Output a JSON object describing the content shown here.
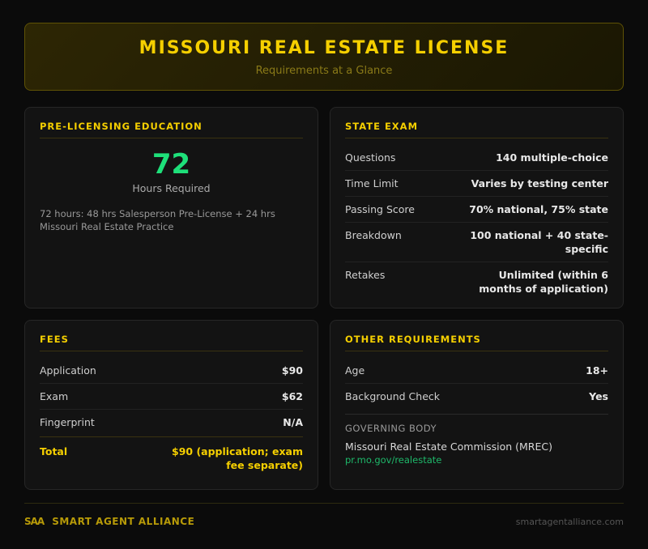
{
  "header": {
    "title": "MISSOURI REAL ESTATE LICENSE",
    "subtitle": "Requirements at a Glance"
  },
  "education": {
    "title": "PRE-LICENSING EDUCATION",
    "hours": "72",
    "hours_label": "Hours Required",
    "description": "72 hours: 48 hrs Salesperson Pre-License + 24 hrs Missouri Real Estate Practice"
  },
  "exam": {
    "title": "STATE EXAM",
    "rows": [
      {
        "label": "Questions",
        "value": "140 multiple-choice"
      },
      {
        "label": "Time Limit",
        "value": "Varies by testing center"
      },
      {
        "label": "Passing Score",
        "value": "70% national, 75% state"
      },
      {
        "label": "Breakdown",
        "value": "100 national + 40 state-specific"
      },
      {
        "label": "Retakes",
        "value": "Unlimited (within 6 months of application)"
      }
    ]
  },
  "fees": {
    "title": "FEES",
    "rows": [
      {
        "label": "Application",
        "value": "$90"
      },
      {
        "label": "Exam",
        "value": "$62"
      },
      {
        "label": "Fingerprint",
        "value": "N/A"
      }
    ],
    "total_label": "Total",
    "total_value": "$90 (application; exam fee separate)"
  },
  "other": {
    "title": "OTHER REQUIREMENTS",
    "rows": [
      {
        "label": "Age",
        "value": "18+"
      },
      {
        "label": "Background Check",
        "value": "Yes"
      }
    ],
    "governing_label": "GOVERNING BODY",
    "governing_name": "Missouri Real Estate Commission (MREC)",
    "governing_link": "pr.mo.gov/realestate"
  },
  "footer": {
    "logo": "SAA",
    "brand": "SMART AGENT ALLIANCE",
    "site": "smartagentalliance.com"
  }
}
